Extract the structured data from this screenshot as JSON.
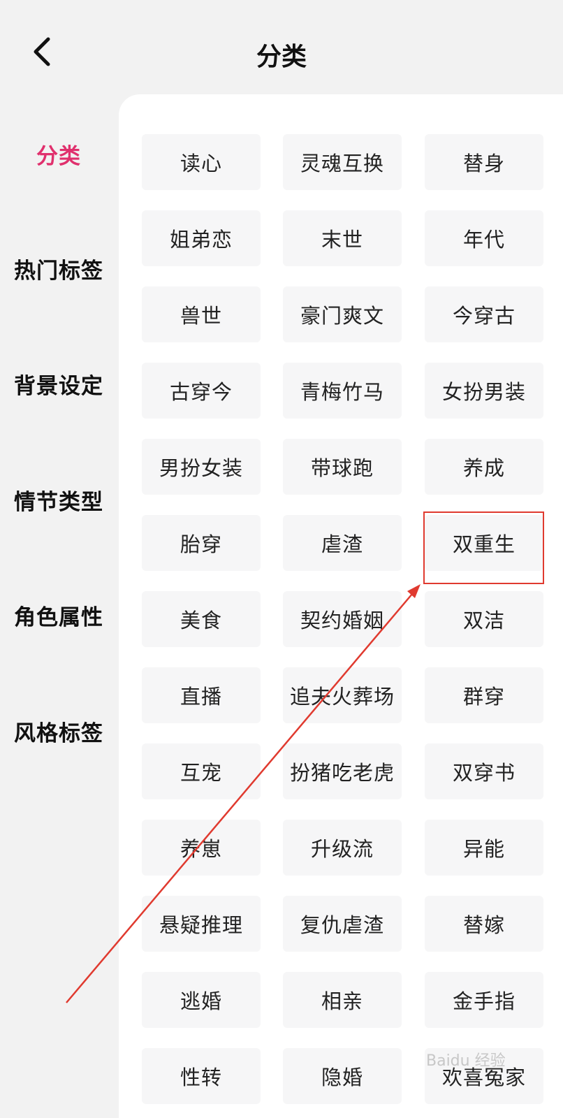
{
  "header": {
    "title": "分类",
    "back_icon": "chevron-left-icon"
  },
  "sidebar": {
    "items": [
      {
        "label": "分类",
        "active": true
      },
      {
        "label": "热门标签",
        "active": false
      },
      {
        "label": "背景设定",
        "active": false
      },
      {
        "label": "情节类型",
        "active": false
      },
      {
        "label": "角色属性",
        "active": false
      },
      {
        "label": "风格标签",
        "active": false
      }
    ]
  },
  "tags": [
    "读心",
    "灵魂互换",
    "替身",
    "姐弟恋",
    "末世",
    "年代",
    "兽世",
    "豪门爽文",
    "今穿古",
    "古穿今",
    "青梅竹马",
    "女扮男装",
    "男扮女装",
    "带球跑",
    "养成",
    "胎穿",
    "虐渣",
    "双重生",
    "美食",
    "契约婚姻",
    "双洁",
    "直播",
    "追夫火葬场",
    "群穿",
    "互宠",
    "扮猪吃老虎",
    "双穿书",
    "养崽",
    "升级流",
    "异能",
    "悬疑推理",
    "复仇虐渣",
    "替嫁",
    "逃婚",
    "相亲",
    "金手指",
    "性转",
    "隐婚",
    "欢喜冤家"
  ],
  "annotation": {
    "highlighted_tag": "双重生",
    "color": "#e03a2f"
  },
  "watermark": "Baidu 经验"
}
